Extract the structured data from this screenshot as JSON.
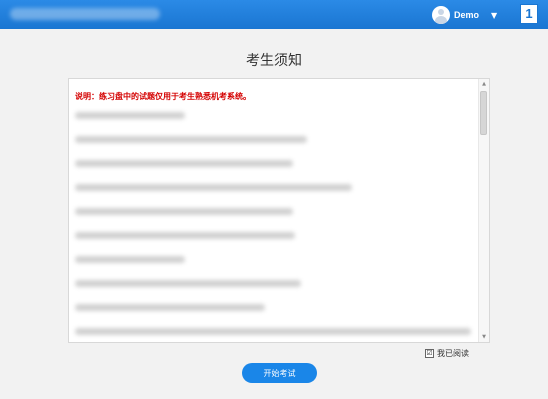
{
  "topbar": {
    "brand_color": "#1a76d2",
    "user": {
      "name": "Demo",
      "avatar_icon": "avatar-icon",
      "caret": "▼"
    },
    "badge_label": "1"
  },
  "page_title": "考生须知",
  "notice": {
    "intro": "说明：练习盘中的试题仅用于考生熟悉机考系统。"
  },
  "read_confirm": {
    "checked_mark": "☑",
    "label": "我已阅读"
  },
  "start_button": {
    "label": "开始考试",
    "color": "#1a86e8"
  }
}
